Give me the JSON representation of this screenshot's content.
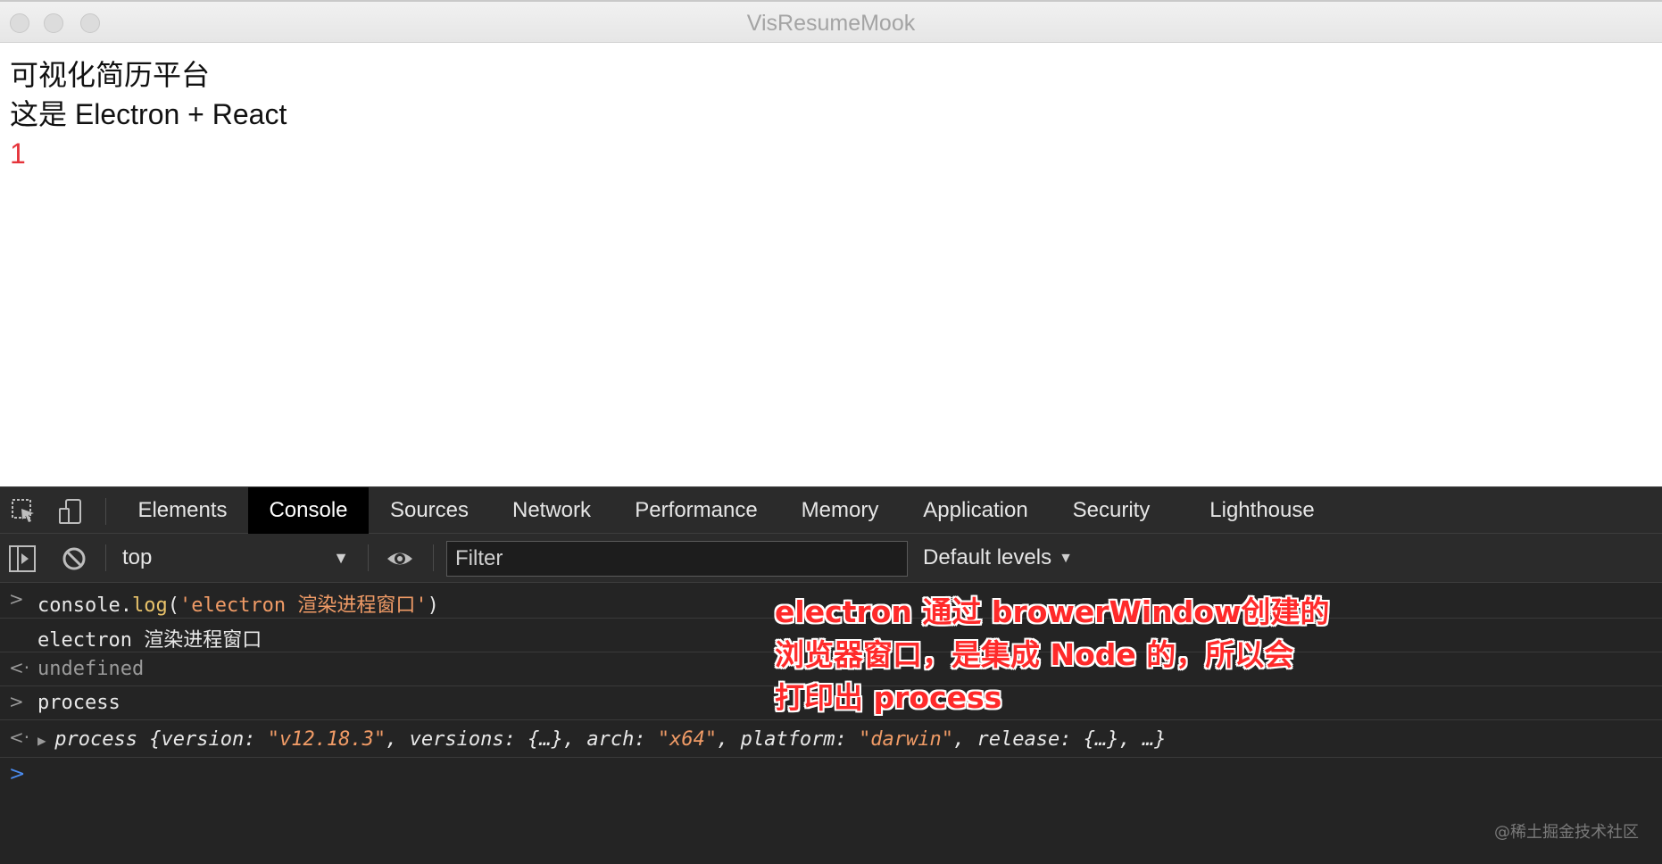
{
  "window": {
    "title": "VisResumeMook"
  },
  "page": {
    "lines": [
      "可视化简历平台",
      "这是 Electron + React",
      "1"
    ]
  },
  "devtools": {
    "tabs": [
      "Elements",
      "Console",
      "Sources",
      "Network",
      "Performance",
      "Memory",
      "Application",
      "Security",
      "Lighthouse"
    ],
    "active_tab": "Console",
    "toolbar": {
      "context": "top",
      "filter_placeholder": "Filter",
      "levels": "Default levels"
    },
    "console": {
      "line1": {
        "obj": "console",
        "dot": ".",
        "method": "log",
        "open": "(",
        "str": "'electron 渲染进程窗口'",
        "close": ")"
      },
      "line2": "electron 渲染进程窗口",
      "line3": "undefined",
      "line4": "process",
      "line5": {
        "name": "process",
        "k1": "version",
        "v1": "\"v12.18.3\"",
        "k2": "versions",
        "v2": "{…}",
        "k3": "arch",
        "v3": "\"x64\"",
        "k4": "platform",
        "v4": "\"darwin\"",
        "k5": "release",
        "v5": "{…}"
      }
    }
  },
  "annotation": {
    "lines": [
      "electron 通过 browerWindow创建的",
      "浏览器窗口，是集成 Node 的，所以会",
      "打印出 process"
    ]
  },
  "watermark": "@稀土掘金技术社区",
  "colors": {
    "annotation": "#ff2a2a",
    "page_number": "#e5333a",
    "devtools_bg": "#242424",
    "string": "#f09b66",
    "method": "#e8c26a"
  }
}
